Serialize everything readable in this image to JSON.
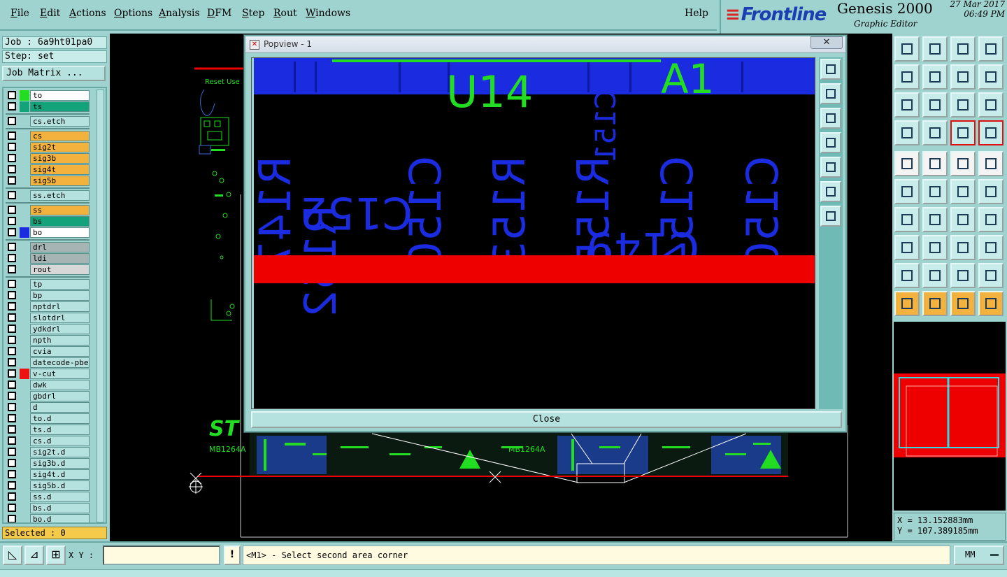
{
  "menu": {
    "items": [
      "File",
      "Edit",
      "Actions",
      "Options",
      "Analysis",
      "DFM",
      "Step",
      "Rout",
      "Windows"
    ],
    "help": "Help"
  },
  "brand": {
    "logo": "Frontline",
    "title": "Genesis 2000",
    "subtitle": "Graphic Editor",
    "date": "27 Mar 2017",
    "time": "06:49 PM"
  },
  "left": {
    "job": "Job : 6a9ht01pa0",
    "step": "Step: set",
    "job_matrix": "Job Matrix ...",
    "selected": "Selected : 0",
    "layers": [
      {
        "name": "to",
        "swatch": "#22dd22",
        "bg": "#ffffff"
      },
      {
        "name": "ts",
        "swatch": "#13a27a",
        "bg": "#13a27a"
      },
      {
        "name": "cs.etch",
        "swatch": "",
        "bg": "#b5e2df"
      },
      {
        "name": "cs",
        "swatch": "",
        "bg": "#f3b23e"
      },
      {
        "name": "sig2t",
        "swatch": "",
        "bg": "#f3b23e"
      },
      {
        "name": "sig3b",
        "swatch": "",
        "bg": "#f3b23e"
      },
      {
        "name": "sig4t",
        "swatch": "",
        "bg": "#f3b23e"
      },
      {
        "name": "sig5b",
        "swatch": "",
        "bg": "#f3b23e"
      },
      {
        "name": "ss.etch",
        "swatch": "",
        "bg": "#b5e2df"
      },
      {
        "name": "ss",
        "swatch": "",
        "bg": "#f3b23e"
      },
      {
        "name": "bs",
        "swatch": "",
        "bg": "#13a27a"
      },
      {
        "name": "bo",
        "swatch": "#1a2be0",
        "bg": "#ffffff"
      },
      {
        "name": "drl",
        "swatch": "",
        "bg": "#a6b4b3"
      },
      {
        "name": "ldi",
        "swatch": "",
        "bg": "#a6b4b3"
      },
      {
        "name": "rout",
        "swatch": "",
        "bg": "#d7d7d7"
      },
      {
        "name": "tp",
        "swatch": "",
        "bg": "#b5e2df"
      },
      {
        "name": "bp",
        "swatch": "",
        "bg": "#b5e2df"
      },
      {
        "name": "nptdrl",
        "swatch": "",
        "bg": "#b5e2df"
      },
      {
        "name": "slotdrl",
        "swatch": "",
        "bg": "#b5e2df"
      },
      {
        "name": "ydkdrl",
        "swatch": "",
        "bg": "#b5e2df"
      },
      {
        "name": "npth",
        "swatch": "",
        "bg": "#b5e2df"
      },
      {
        "name": "cvia",
        "swatch": "",
        "bg": "#b5e2df"
      },
      {
        "name": "datecode-pbe",
        "swatch": "",
        "bg": "#b5e2df"
      },
      {
        "name": "v-cut",
        "swatch": "#ee1111",
        "bg": "#b5e2df"
      },
      {
        "name": "dwk",
        "swatch": "",
        "bg": "#b5e2df"
      },
      {
        "name": "gbdrl",
        "swatch": "",
        "bg": "#b5e2df"
      },
      {
        "name": "d",
        "swatch": "",
        "bg": "#b5e2df"
      },
      {
        "name": "to.d",
        "swatch": "",
        "bg": "#b5e2df"
      },
      {
        "name": "ts.d",
        "swatch": "",
        "bg": "#b5e2df"
      },
      {
        "name": "cs.d",
        "swatch": "",
        "bg": "#b5e2df"
      },
      {
        "name": "sig2t.d",
        "swatch": "",
        "bg": "#b5e2df"
      },
      {
        "name": "sig3b.d",
        "swatch": "",
        "bg": "#b5e2df"
      },
      {
        "name": "sig4t.d",
        "swatch": "",
        "bg": "#b5e2df"
      },
      {
        "name": "sig5b.d",
        "swatch": "",
        "bg": "#b5e2df"
      },
      {
        "name": "ss.d",
        "swatch": "",
        "bg": "#b5e2df"
      },
      {
        "name": "bs.d",
        "swatch": "",
        "bg": "#b5e2df"
      },
      {
        "name": "bo.d",
        "swatch": "",
        "bg": "#b5e2df"
      }
    ]
  },
  "canvas": {
    "reset_label": "Reset Use",
    "board_label_left": "MB1264A",
    "board_label_right": "MB1264A",
    "st_logo": "ST"
  },
  "popup": {
    "title": "Popview - 1",
    "close_x": "✕",
    "close_button": "Close",
    "silk_top": [
      "U14",
      "A1"
    ],
    "bo_labels": [
      "R147",
      "R152",
      "C152",
      "C150",
      "R153",
      "C149",
      "R155",
      "C154",
      "C150",
      "C151"
    ]
  },
  "right": {
    "x_readout": "X = 13.152883mm",
    "y_readout": "Y = 107.389185mm"
  },
  "bottom": {
    "xy_label": "X Y :",
    "xy_value": "",
    "warn": "!",
    "status": "<M1> - Select second area corner",
    "units": "MM"
  },
  "colors": {
    "panel": "#9fd3cf",
    "bo_layer": "#1a2be0",
    "silk_green": "#22dd22",
    "vcut_red": "#ee0000"
  }
}
